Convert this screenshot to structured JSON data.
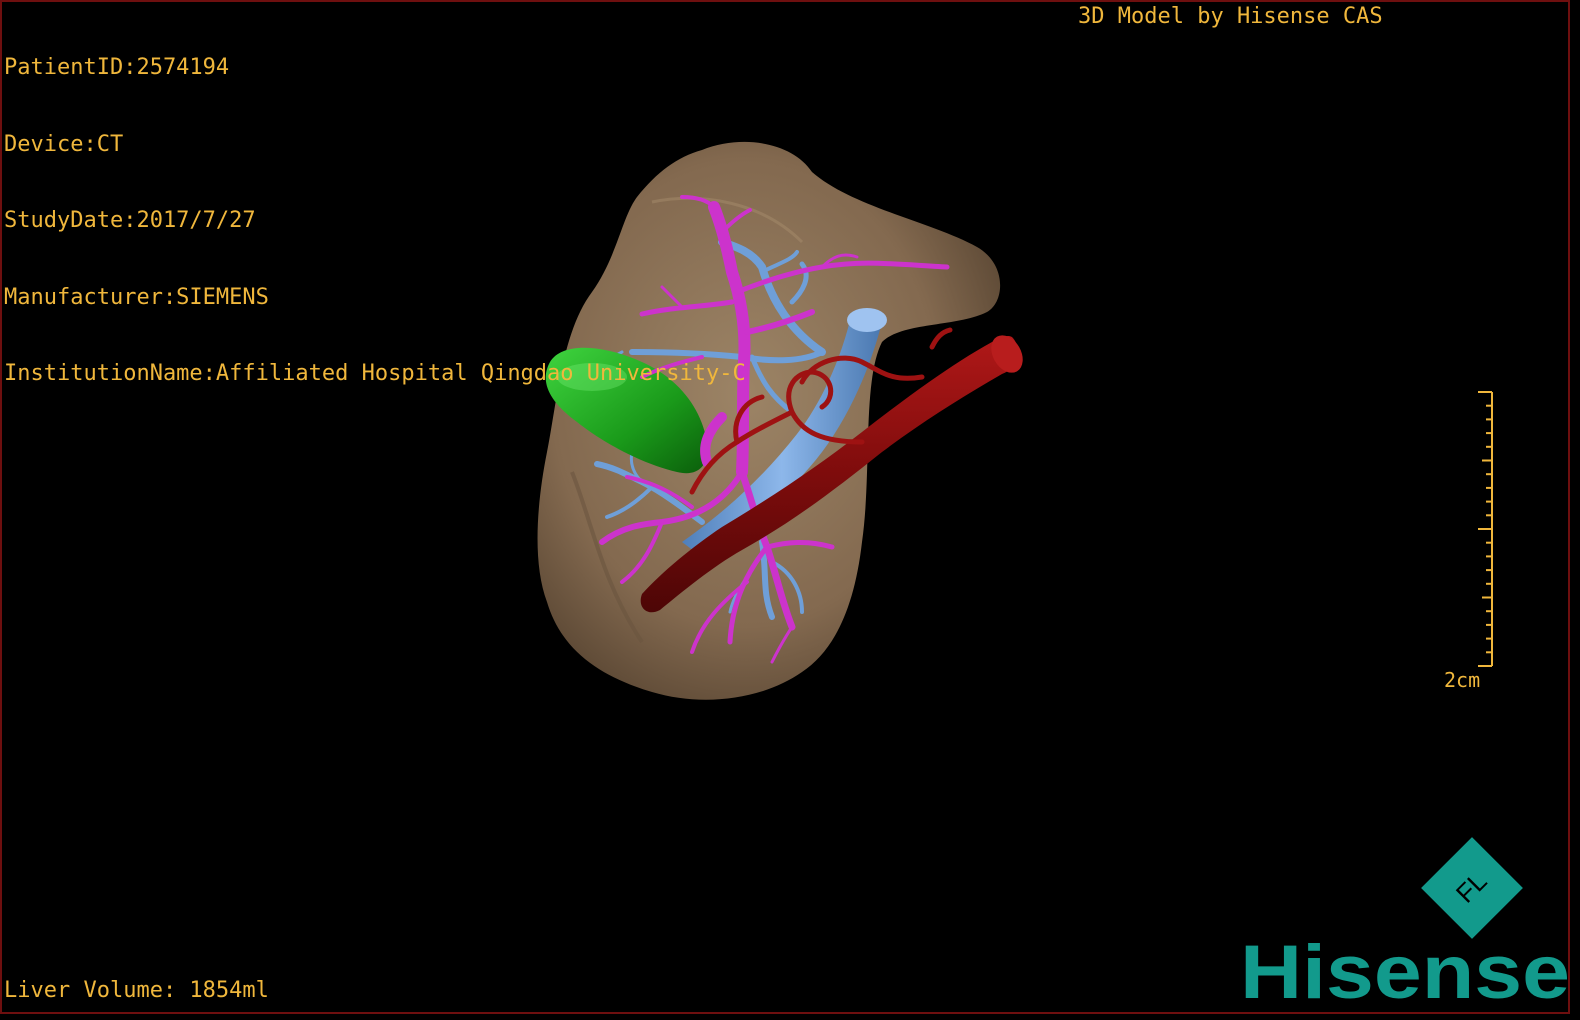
{
  "overlay": {
    "patient_id": "PatientID:2574194",
    "device": "Device:CT",
    "study_date": "StudyDate:2017/7/27",
    "manufacturer": "Manufacturer:SIEMENS",
    "institution": "InstitutionName:Affiliated Hospital Qingdao University-C",
    "model_credit": "3D Model by Hisense CAS",
    "liver_volume": "Liver Volume: 1854ml"
  },
  "scale": {
    "label": "2cm"
  },
  "logo": {
    "brand": "Hisense",
    "badge_letters": "FL"
  },
  "colors": {
    "overlay_text": "#f0b73c",
    "liver": "#8c7358",
    "gallbladder": "#1f9d1f",
    "portal_vein": "#cc33cc",
    "hepatic_vein": "#6f9fd8",
    "artery": "#8f0f0f",
    "brand_teal": "#129a8c",
    "frame": "#6e0f0f"
  },
  "structures": [
    "liver",
    "gallbladder",
    "portal-vein",
    "hepatic-vein",
    "vena-cava",
    "aorta",
    "hepatic-artery"
  ]
}
